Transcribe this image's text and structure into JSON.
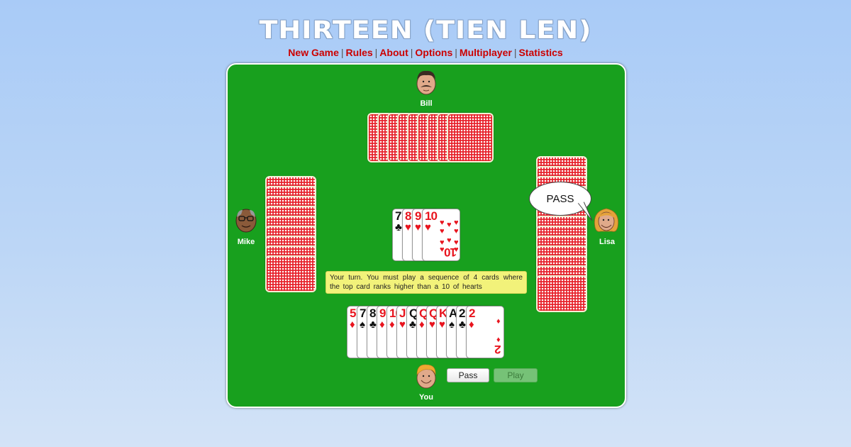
{
  "page": {
    "title": "THIRTEEN (TIEN LEN)",
    "nav": [
      "New Game",
      "Rules",
      "About",
      "Options",
      "Multiplayer",
      "Statistics"
    ],
    "nav_separator": "|"
  },
  "players": {
    "top": {
      "name": "Bill",
      "card_count": 9
    },
    "left": {
      "name": "Mike",
      "card_count": 9
    },
    "right": {
      "name": "Lisa",
      "card_count": 13,
      "speech": "PASS"
    },
    "bottom": {
      "name": "You"
    }
  },
  "trick": [
    {
      "rank": "7",
      "suit": "♣",
      "color": "black"
    },
    {
      "rank": "8",
      "suit": "♥",
      "color": "red"
    },
    {
      "rank": "9",
      "suit": "♥",
      "color": "red"
    },
    {
      "rank": "10",
      "suit": "♥",
      "color": "red"
    }
  ],
  "message": "Your turn. You must play a sequence of 4 cards where the top card ranks higher than a 10 of hearts",
  "hand": [
    {
      "rank": "5",
      "suit": "♦",
      "color": "red"
    },
    {
      "rank": "7",
      "suit": "♠",
      "color": "black"
    },
    {
      "rank": "8",
      "suit": "♣",
      "color": "black"
    },
    {
      "rank": "9",
      "suit": "♦",
      "color": "red"
    },
    {
      "rank": "10",
      "suit": "♦",
      "color": "red"
    },
    {
      "rank": "J",
      "suit": "♥",
      "color": "red"
    },
    {
      "rank": "Q",
      "suit": "♣",
      "color": "black"
    },
    {
      "rank": "Q",
      "suit": "♦",
      "color": "red"
    },
    {
      "rank": "Q",
      "suit": "♥",
      "color": "red"
    },
    {
      "rank": "K",
      "suit": "♥",
      "color": "red"
    },
    {
      "rank": "A",
      "suit": "♠",
      "color": "black"
    },
    {
      "rank": "2",
      "suit": "♣",
      "color": "black"
    },
    {
      "rank": "2",
      "suit": "♦",
      "color": "red"
    }
  ],
  "buttons": {
    "pass": "Pass",
    "play": "Play",
    "play_enabled": false
  },
  "colors": {
    "table": "#18a01e",
    "nav_link": "#cc0000",
    "message_bg": "#f2f27a"
  }
}
